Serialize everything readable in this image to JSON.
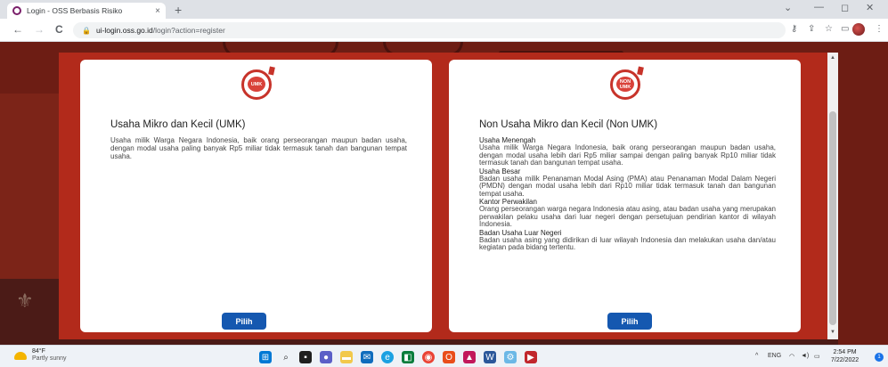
{
  "browser": {
    "tab_title": "Login - OSS Berbasis Risiko",
    "tab_close": "×",
    "new_tab": "+",
    "url_host": "ui-login.oss.go.id",
    "url_path": "/login?action=register",
    "back": "←",
    "forward": "→",
    "reload": "C"
  },
  "modal": {
    "umk": {
      "badge_text": "UMK",
      "title": "Usaha Mikro dan Kecil (UMK)",
      "description": "Usaha milik Warga Negara Indonesia, baik orang perseorangan maupun badan usaha, dengan modal usaha paling banyak Rp5 miliar tidak termasuk tanah dan bangunan tempat usaha.",
      "button": "Pilih"
    },
    "non_umk": {
      "badge_text": "NON UMK",
      "title": "Non Usaha Mikro dan Kecil (Non UMK)",
      "sections": [
        {
          "heading": "Usaha Menengah",
          "text": "Usaha milik Warga Negara Indonesia, baik orang perseorangan maupun badan usaha, dengan modal usaha lebih dari Rp5 miliar sampai dengan paling banyak Rp10 miliar tidak termasuk tanah dan bangunan tempat usaha."
        },
        {
          "heading": "Usaha Besar",
          "text": "Badan usaha milik Penanaman Modal Asing (PMA) atau Penanaman Modal Dalam Negeri (PMDN) dengan modal usaha lebih dari Rp10 miliar tidak termasuk tanah dan bangunan tempat usaha."
        },
        {
          "heading": "Kantor Perwakilan",
          "text": "Orang perseorangan warga negara Indonesia atau asing, atau badan usaha yang merupakan perwakilan pelaku usaha dari luar negeri dengan persetujuan pendirian kantor di wilayah Indonesia."
        },
        {
          "heading": "Badan Usaha Luar Negeri",
          "text": "Badan usaha asing yang didirikan di luar wilayah Indonesia dan melakukan usaha dan/atau kegiatan pada bidang tertentu."
        }
      ],
      "button": "Pilih"
    }
  },
  "taskbar": {
    "weather_temp": "84°F",
    "weather_desc": "Partly sunny",
    "lang": "ENG",
    "time": "2:54 PM",
    "date": "7/22/2022",
    "notification_count": "1"
  },
  "colors": {
    "modal_bg": "#b22a1b",
    "button": "#1558b0",
    "badge": "#c7332a"
  }
}
